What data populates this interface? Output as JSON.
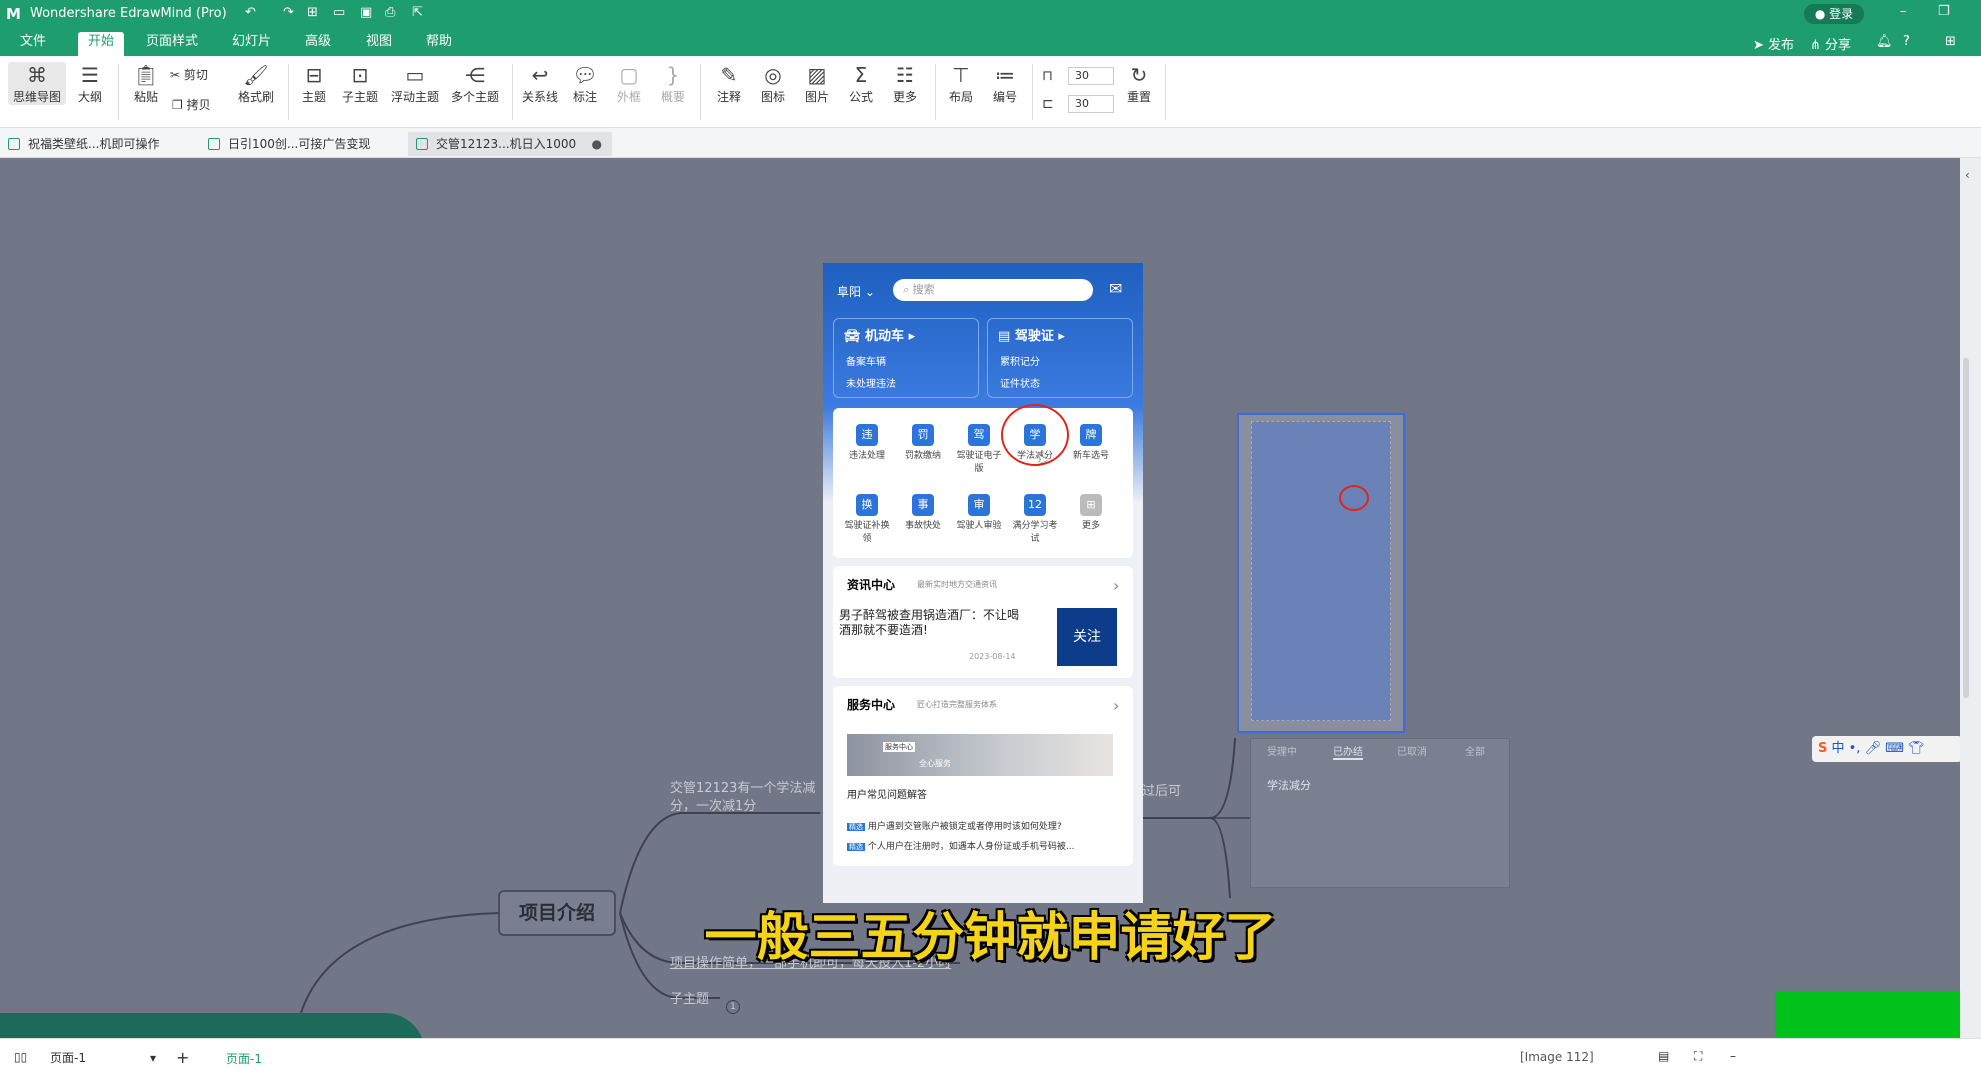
{
  "app": {
    "title": "Wondershare EdrawMind (Pro)",
    "login": "登录"
  },
  "menu": [
    "文件",
    "开始",
    "页面样式",
    "幻灯片",
    "高级",
    "视图",
    "帮助"
  ],
  "right_menu": {
    "publish": "发布",
    "share": "分享"
  },
  "ribbon": {
    "mindmap": "思维导图",
    "outline": "大纲",
    "paste": "粘贴",
    "cut": "剪切",
    "copy": "拷贝",
    "format_painter": "格式刷",
    "topic": "主题",
    "subtopic": "子主题",
    "floating": "浮动主题",
    "multi": "多个主题",
    "relation": "关系线",
    "callout": "标注",
    "boundary": "外框",
    "summary": "概要",
    "note": "注释",
    "icon": "图标",
    "image": "图片",
    "formula": "公式",
    "more": "更多",
    "layout": "布局",
    "numbering": "编号",
    "spin1": "30",
    "spin2": "30",
    "reset": "重置"
  },
  "doc_tabs": [
    "祝福类壁纸...机即可操作",
    "日引100创...可接广告变现",
    "交管12123...机日入1000"
  ],
  "phone": {
    "city": "阜阳",
    "search": "搜索",
    "card1_title": "机动车",
    "card1_l1": "备案车辆",
    "card1_l2": "未处理违法",
    "card2_title": "驾驶证",
    "card2_l1": "累积记分",
    "card2_l2": "证件状态",
    "icons": [
      "违法处理",
      "罚款缴纳",
      "驾驶证电子版",
      "学法减分",
      "新车选号",
      "驾驶证补换领",
      "事故快处",
      "驾驶人审验",
      "满分学习考试",
      "更多"
    ],
    "news_title": "资讯中心",
    "news_sub": "最新实时地方交通资讯",
    "news_text": "男子醉驾被查用锅造酒厂：不让喝酒那就不要造酒!",
    "news_date": "2023-08-14",
    "news_badge": "关注",
    "service_title": "服务中心",
    "service_sub": "匠心打造完整服务体系",
    "service_banner": "全心服务",
    "service_tag": "服务中心",
    "faq_title": "用户常见问题解答",
    "faq1": "用户遇到交管账户被锁定或者停用时该如何处理?",
    "faq2": "个人用户在注册时，如遇本人身份证或手机号码被...",
    "faq_tag": "精选"
  },
  "mindmap": {
    "main_node": "项目介绍",
    "n1": "交管12123有一个学法减分，一次减1分",
    "n2": "项目操作简单，一部手机即可，每天投入1-2小时",
    "n3": "子主题",
    "n4": "过后可",
    "tabs": [
      "受理中",
      "已办结",
      "已取消",
      "全部"
    ],
    "detail_title": "学法减分"
  },
  "subtitle": "一般三五分钟就申请好了",
  "status": {
    "page_select": "页面-1",
    "page_tab": "页面-1",
    "image_label": "[Image 112]"
  }
}
